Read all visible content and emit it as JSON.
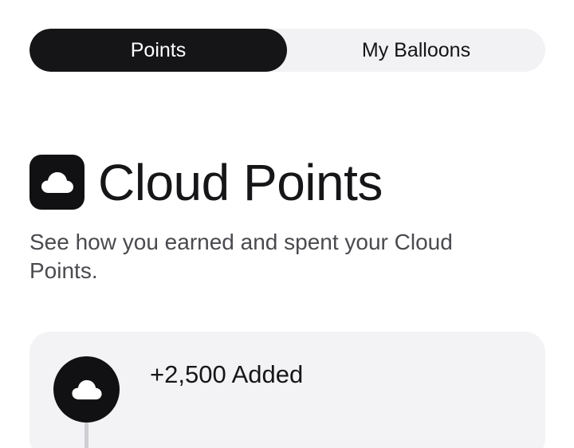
{
  "tabs": [
    {
      "label": "Points",
      "active": true
    },
    {
      "label": "My Balloons",
      "active": false
    }
  ],
  "header": {
    "icon": "cloud-icon",
    "title": "Cloud Points",
    "subtitle": "See how you earned and spent your Cloud Points."
  },
  "entries": [
    {
      "icon": "cloud-icon",
      "label": "+2,500 Added"
    }
  ],
  "colors": {
    "active_tab_bg": "#151517",
    "tab_track_bg": "#f2f2f4",
    "card_bg": "#f3f3f5",
    "icon_bg": "#111113"
  }
}
